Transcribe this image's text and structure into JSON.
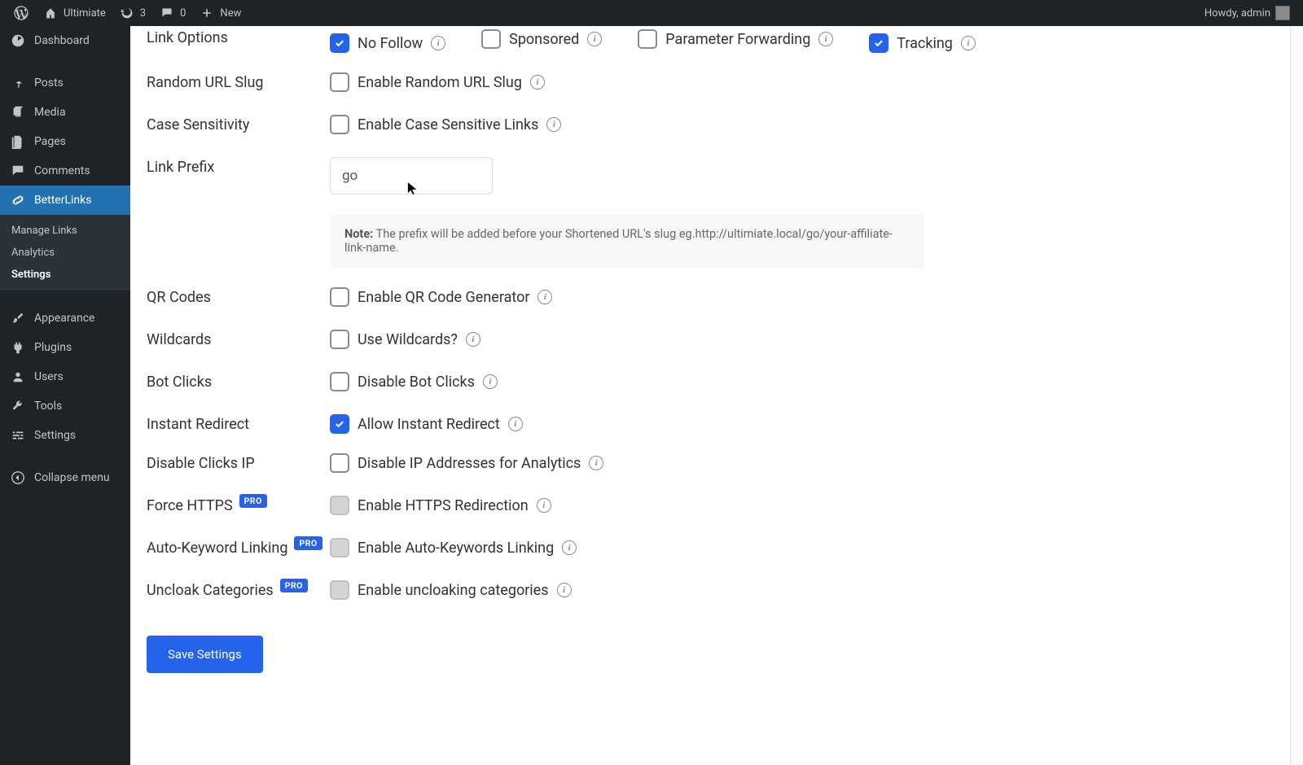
{
  "adminBar": {
    "siteName": "Ultimiate",
    "updates": "3",
    "comments": "0",
    "newLabel": "New",
    "greeting": "Howdy, admin"
  },
  "sidebar": {
    "dashboard": "Dashboard",
    "posts": "Posts",
    "media": "Media",
    "pages": "Pages",
    "comments": "Comments",
    "betterlinks": "BetterLinks",
    "manageLinks": "Manage Links",
    "analytics": "Analytics",
    "settings": "Settings",
    "appearance": "Appearance",
    "plugins": "Plugins",
    "users": "Users",
    "tools": "Tools",
    "settingsMain": "Settings",
    "collapse": "Collapse menu"
  },
  "rows": {
    "linkOptions": {
      "label": "Link Options",
      "noFollow": "No Follow",
      "sponsored": "Sponsored",
      "paramForward": "Parameter Forwarding",
      "tracking": "Tracking"
    },
    "randomSlug": {
      "label": "Random URL Slug",
      "opt": "Enable Random URL Slug"
    },
    "caseSens": {
      "label": "Case Sensitivity",
      "opt": "Enable Case Sensitive Links"
    },
    "linkPrefix": {
      "label": "Link Prefix",
      "value": "go",
      "noteLabel": "Note:",
      "noteText": " The prefix will be added before your Shortened URL's slug eg.http://ultimiate.local/go/your-affiliate-link-name."
    },
    "qr": {
      "label": "QR Codes",
      "opt": "Enable QR Code Generator"
    },
    "wildcards": {
      "label": "Wildcards",
      "opt": "Use Wildcards?"
    },
    "botClicks": {
      "label": "Bot Clicks",
      "opt": "Disable Bot Clicks"
    },
    "instant": {
      "label": "Instant Redirect",
      "opt": "Allow Instant Redirect"
    },
    "disableIP": {
      "label": "Disable Clicks IP",
      "opt": "Disable IP Addresses for Analytics"
    },
    "forceHttps": {
      "label": "Force HTTPS",
      "opt": "Enable HTTPS Redirection"
    },
    "autoKeyword": {
      "label": "Auto-Keyword Linking",
      "opt": "Enable Auto-Keywords Linking"
    },
    "uncloak": {
      "label": "Uncloak Categories",
      "opt": "Enable uncloaking categories"
    }
  },
  "proBadge": "PRO",
  "saveButton": "Save Settings"
}
